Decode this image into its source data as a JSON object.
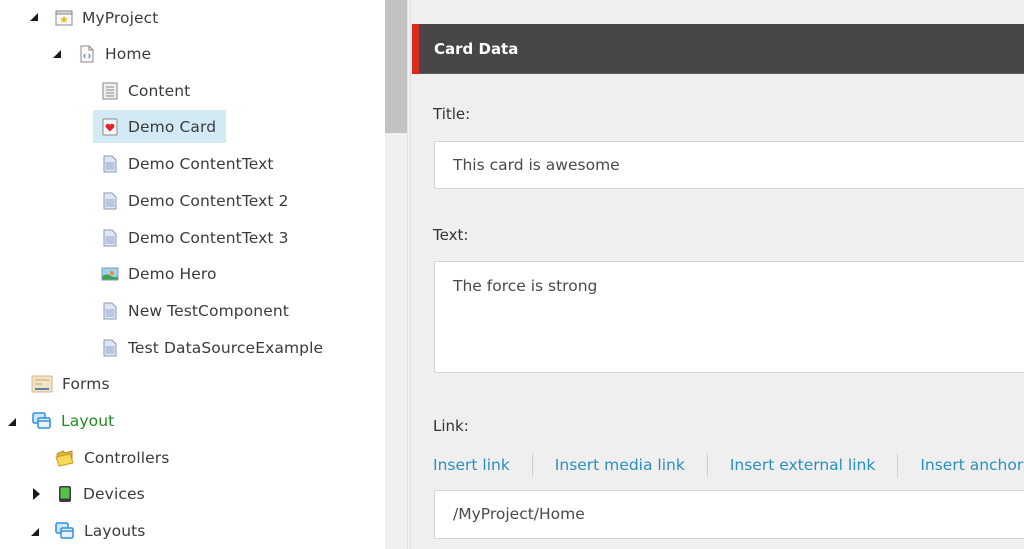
{
  "tree": {
    "items": [
      {
        "label": "MyProject",
        "icon": "project-star-icon",
        "expanded": true
      },
      {
        "label": "Home",
        "icon": "page-code-icon",
        "expanded": true
      },
      {
        "label": "Content",
        "icon": "content-list-icon"
      },
      {
        "label": "Demo Card",
        "icon": "card-heart-icon",
        "selected": true
      },
      {
        "label": "Demo ContentText",
        "icon": "document-icon"
      },
      {
        "label": "Demo ContentText 2",
        "icon": "document-icon"
      },
      {
        "label": "Demo ContentText 3",
        "icon": "document-icon"
      },
      {
        "label": "Demo Hero",
        "icon": "image-icon"
      },
      {
        "label": "New TestComponent",
        "icon": "document-icon"
      },
      {
        "label": "Test DataSourceExample",
        "icon": "document-icon"
      },
      {
        "label": "Forms",
        "icon": "forms-icon"
      },
      {
        "label": "Layout",
        "icon": "windows-icon",
        "expanded": true,
        "highlight_color": "#1e8a1e"
      },
      {
        "label": "Controllers",
        "icon": "folder-icon"
      },
      {
        "label": "Devices",
        "icon": "device-icon",
        "expanded": false
      },
      {
        "label": "Layouts",
        "icon": "windows-icon",
        "expanded": true
      }
    ]
  },
  "editor": {
    "section_title": "Card Data",
    "accent_color": "#dc291e",
    "fields": {
      "title": {
        "label": "Title:",
        "value": "This card is awesome"
      },
      "text": {
        "label": "Text:",
        "value": "The force is strong"
      },
      "link": {
        "label": "Link:",
        "actions": [
          "Insert link",
          "Insert media link",
          "Insert external link",
          "Insert anchor"
        ],
        "value": "/MyProject/Home"
      }
    }
  },
  "colors": {
    "link": "#2b8fbf",
    "selection": "#d3eaf5",
    "header_bg": "#474747"
  }
}
